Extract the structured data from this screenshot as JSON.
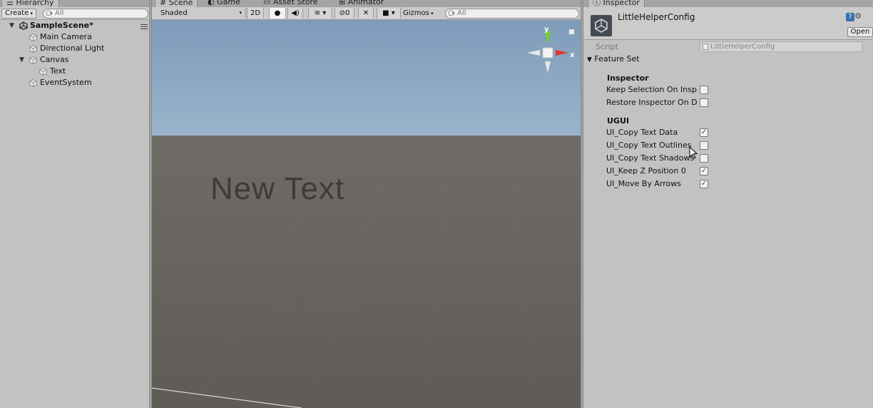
{
  "hierarchy": {
    "tab_label": "Hierarchy",
    "create_label": "Create",
    "search_placeholder": "All",
    "scene_name": "SampleScene*",
    "items": [
      {
        "label": "Main Camera"
      },
      {
        "label": "Directional Light"
      },
      {
        "label": "Canvas"
      },
      {
        "label": "Text"
      },
      {
        "label": "EventSystem"
      }
    ]
  },
  "scene": {
    "tabs": [
      {
        "label": "# Scene"
      },
      {
        "label": "Game"
      },
      {
        "label": "Asset Store"
      },
      {
        "label": "Animator"
      }
    ],
    "toolbar": {
      "shading_mode": "Shaded",
      "mode_2d": "2D",
      "hidden_count": "0",
      "gizmos_label": "Gizmos",
      "search_placeholder": "All"
    },
    "gizmo": {
      "axis_y": "y",
      "axis_x": "x"
    },
    "scene_text": "New Text"
  },
  "inspector": {
    "tab_label": "Inspector",
    "asset_name": "LittleHelperConfig",
    "open_label": "Open",
    "script_label": "Script",
    "script_value": "LittleHelperConfig",
    "feature_set_label": "Feature Set",
    "sections": [
      {
        "title": "Inspector",
        "props": [
          {
            "label": "Keep Selection On Insp",
            "checked": false
          },
          {
            "label": "Restore Inspector On D",
            "checked": false
          }
        ]
      },
      {
        "title": "UGUI",
        "props": [
          {
            "label": "UI_Copy Text Data",
            "checked": true
          },
          {
            "label": "UI_Copy Text Outlines",
            "checked": false
          },
          {
            "label": "UI_Copy Text Shadows",
            "checked": false
          },
          {
            "label": "UI_Keep Z Position 0",
            "checked": true
          },
          {
            "label": "UI_Move By Arrows",
            "checked": true
          }
        ]
      }
    ]
  },
  "colors": {
    "panel_bg": "#c2c2c2",
    "checkmark": "#1a4d9b",
    "gizmo_y": "#6fcf2f",
    "gizmo_x": "#e03a2a"
  }
}
